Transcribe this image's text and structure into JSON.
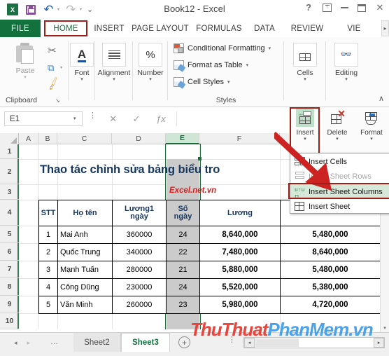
{
  "window": {
    "title": "Book12 - Excel",
    "quick_access": [
      "excel-logo",
      "save-icon",
      "undo-icon",
      "redo-icon",
      "customize-icon"
    ],
    "buttons": {
      "help": "?",
      "ribbon_display": "ribbon-options-icon",
      "minimize": "minimize-icon",
      "restore": "restore-icon",
      "close": "✕"
    }
  },
  "ribbon": {
    "tabs": [
      {
        "label": "FILE"
      },
      {
        "label": "HOME"
      },
      {
        "label": "INSERT"
      },
      {
        "label": "PAGE LAYOUT"
      },
      {
        "label": "FORMULAS"
      },
      {
        "label": "DATA"
      },
      {
        "label": "REVIEW"
      },
      {
        "label": "VIE"
      }
    ],
    "active_tab": "HOME",
    "tab_scroll": "▸",
    "groups": {
      "clipboard": {
        "label": "Clipboard",
        "paste": "Paste",
        "paste_caret": "▾",
        "cut": "✂",
        "copy": "⧉",
        "copy_caret": "▾",
        "format_painter": "🖌",
        "dialog_launcher": "↘"
      },
      "font": {
        "label": "Font",
        "caret": "▾",
        "glyph": "A"
      },
      "alignment": {
        "label": "Alignment",
        "caret": "▾"
      },
      "number": {
        "label": "Number",
        "caret": "▾",
        "glyph": "%"
      },
      "styles": {
        "label": "Styles",
        "items": [
          {
            "label": "Conditional Formatting",
            "caret": "▾"
          },
          {
            "label": "Format as Table",
            "caret": "▾"
          },
          {
            "label": "Cell Styles",
            "caret": "▾"
          }
        ]
      },
      "cells": {
        "label": "Cells",
        "caret": "▾"
      },
      "editing": {
        "label": "Editing",
        "caret": "▾"
      }
    },
    "collapse": "∧",
    "cells_buttons": [
      {
        "label": "Insert",
        "caret": "▾"
      },
      {
        "label": "Delete",
        "caret": "▾"
      },
      {
        "label": "Format",
        "caret": "▾"
      }
    ]
  },
  "formula_bar": {
    "name_box_value": "E1",
    "name_box_caret": "▾",
    "more_dots": "⋮",
    "cancel": "✕",
    "enter": "✓",
    "insert_function": "ƒx",
    "formula_value": ""
  },
  "insert_menu": {
    "items": [
      {
        "label": "Insert Cells",
        "state": "normal",
        "icon": "insert-cells-icon"
      },
      {
        "label": "Insert Sheet Rows",
        "state": "disabled",
        "icon": "insert-rows-icon"
      },
      {
        "label": "Insert Sheet Columns",
        "state": "highlighted",
        "icon": "insert-columns-icon"
      },
      {
        "label": "Insert Sheet",
        "state": "normal",
        "icon": "insert-sheet-icon"
      }
    ]
  },
  "grid": {
    "column_headers": [
      "A",
      "B",
      "C",
      "D",
      "E",
      "F"
    ],
    "selected_column": "E",
    "row_headers": [
      "1",
      "2",
      "3",
      "4",
      "5",
      "6",
      "7",
      "8",
      "9",
      "10"
    ],
    "title_text": "Thao tác chỉnh sửa bảng biểu tro",
    "subtitle_text": "Excel.net.vn",
    "table": {
      "headers": [
        "STT",
        "Họ tên",
        "Lương1\nngày",
        "Số\nngày",
        "Lương",
        ""
      ],
      "header_parts": [
        {
          "line1": "STT",
          "line2": ""
        },
        {
          "line1": "Họ tên",
          "line2": ""
        },
        {
          "line1": "Lương1",
          "line2": "ngày"
        },
        {
          "line1": "Số",
          "line2": "ngày"
        },
        {
          "line1": "Lương",
          "line2": ""
        },
        {
          "line1": "",
          "line2": ""
        }
      ],
      "rows": [
        {
          "stt": "1",
          "name": "Mai Anh",
          "daily": "360000",
          "days": "24",
          "salary": "8,640,000",
          "extra": "5,480,000"
        },
        {
          "stt": "2",
          "name": "Quốc Trung",
          "daily": "340000",
          "days": "22",
          "salary": "7,480,000",
          "extra": "8,640,000"
        },
        {
          "stt": "3",
          "name": "Mạnh Tuấn",
          "daily": "280000",
          "days": "21",
          "salary": "5,880,000",
          "extra": "5,480,000"
        },
        {
          "stt": "4",
          "name": "Công Dũng",
          "daily": "230000",
          "days": "24",
          "salary": "5,520,000",
          "extra": "5,380,000"
        },
        {
          "stt": "5",
          "name": "Văn Minh",
          "daily": "260000",
          "days": "23",
          "salary": "5,980,000",
          "extra": "4,720,000"
        }
      ]
    }
  },
  "watermark": {
    "part1": "ThuThuat",
    "part2": "PhanMem",
    "part3": ".vn"
  },
  "sheet_bar": {
    "nav_first": "◂",
    "nav_last": "▸",
    "dots": "…",
    "tabs": [
      {
        "label": "Sheet2",
        "active": false
      },
      {
        "label": "Sheet3",
        "active": true
      }
    ],
    "add_sheet": "+",
    "more_dots": "⋮",
    "scroll_left": "◂",
    "scroll_right": "▸"
  },
  "scrollbar": {
    "up": "▴",
    "down": "▾"
  },
  "colors": {
    "excel_green": "#13713e",
    "highlight_red": "#9c1f19",
    "title_blue": "#17365d",
    "subtitle_red": "#e01b1b",
    "selection_green": "#1e6b3a"
  }
}
